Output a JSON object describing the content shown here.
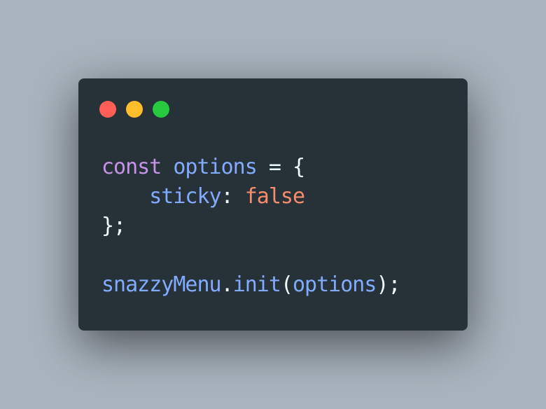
{
  "colors": {
    "background": "#a9b4be",
    "window": "#263238",
    "close_dot": "#ff5f56",
    "minimize_dot": "#ffbd2e",
    "maximize_dot": "#27c93f",
    "keyword": "#c792ea",
    "identifier": "#82aaff",
    "punctuation": "#eeffff",
    "boolean": "#f78c6c"
  },
  "code": {
    "line1": {
      "keyword": "const",
      "space1": " ",
      "var": "options",
      "rest": " = {"
    },
    "line2": {
      "indent": "    ",
      "prop": "sticky",
      "colon": ": ",
      "value": "false"
    },
    "line3": {
      "text": "};"
    },
    "line4": {
      "text": ""
    },
    "line5": {
      "obj": "snazzyMenu",
      "dot": ".",
      "method": "init",
      "open": "(",
      "arg": "options",
      "close": ");"
    }
  }
}
